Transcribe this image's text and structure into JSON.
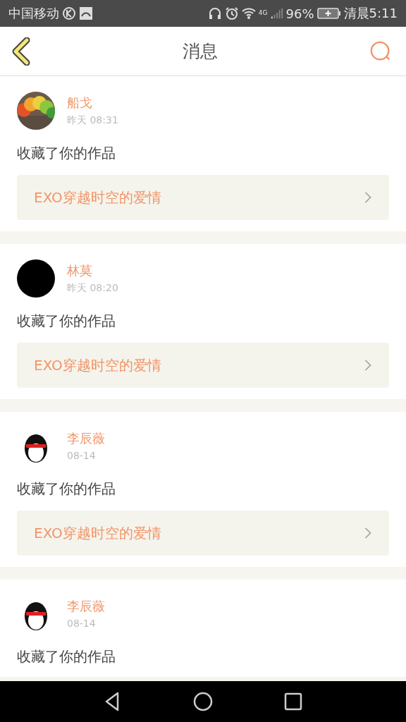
{
  "status_bar": {
    "carrier": "中国移动",
    "network": "4G",
    "battery": "96%",
    "time": "清晨5:11"
  },
  "header": {
    "title": "消息"
  },
  "messages": [
    {
      "name": "船戈",
      "time": "昨天 08:31",
      "text": "收藏了你的作品",
      "work": "EXO穿越时空的爱情"
    },
    {
      "avatar": {
        "kind": "plain"
      },
      "name": "林莫",
      "time": "昨天 08:20",
      "text": "收藏了你的作品",
      "work": "EXO穿越时空的爱情"
    },
    {
      "avatar": {
        "kind": "figure"
      },
      "name": "李辰薇",
      "time": "08-14",
      "text": "收藏了你的作品",
      "work": "EXO穿越时空的爱情"
    },
    {
      "avatar": {
        "kind": "figure"
      },
      "name": "李辰薇",
      "time": "08-14",
      "text": "收藏了你的作品"
    }
  ]
}
